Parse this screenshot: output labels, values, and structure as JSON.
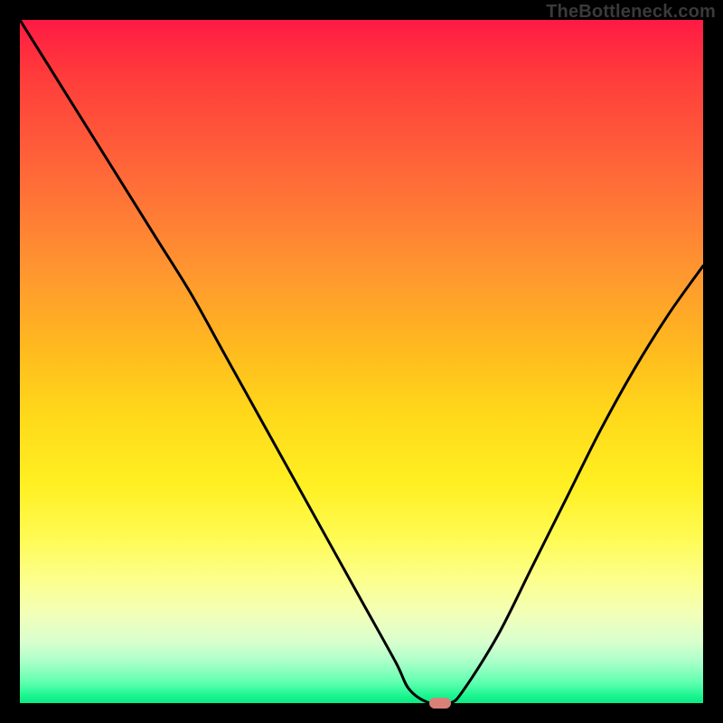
{
  "watermark": "TheBottleneck.com",
  "marker": {
    "color": "#d98079"
  },
  "chart_data": {
    "type": "line",
    "title": "",
    "xlabel": "",
    "ylabel": "",
    "xlim": [
      0,
      100
    ],
    "ylim": [
      0,
      100
    ],
    "grid": false,
    "series": [
      {
        "name": "bottleneck-curve",
        "x": [
          0,
          5,
          10,
          15,
          20,
          25,
          30,
          35,
          40,
          45,
          50,
          55,
          57,
          60,
          63,
          65,
          70,
          75,
          80,
          85,
          90,
          95,
          100
        ],
        "y": [
          100,
          92,
          84,
          76,
          68,
          60,
          51,
          42,
          33,
          24,
          15,
          6,
          2,
          0,
          0,
          2,
          10,
          20,
          30,
          40,
          49,
          57,
          64
        ]
      }
    ],
    "annotations": [
      {
        "type": "marker",
        "x": 61.5,
        "y": 0,
        "shape": "pill",
        "color": "#d98079"
      }
    ]
  }
}
